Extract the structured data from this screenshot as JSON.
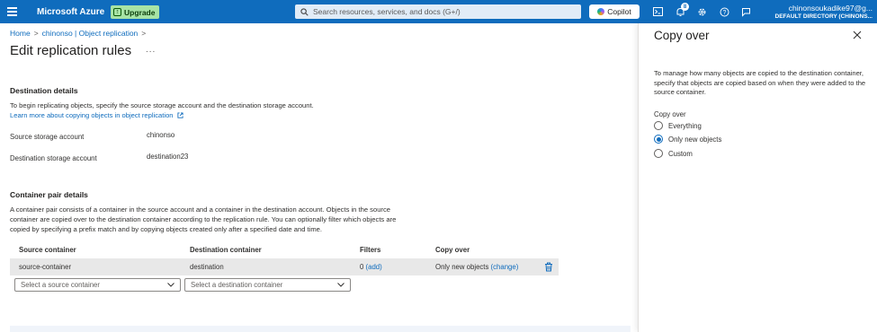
{
  "topbar": {
    "brand": "Microsoft Azure",
    "upgrade_label": "Upgrade",
    "search_placeholder": "Search resources, services, and docs (G+/)",
    "copilot_label": "Copilot",
    "notification_count": "8",
    "account_email": "chinonsoukadike97@g...",
    "account_directory": "DEFAULT DIRECTORY (CHINONS..."
  },
  "breadcrumb": {
    "items": [
      "Home",
      "chinonso | Object replication"
    ],
    "separator": ">"
  },
  "page": {
    "title": "Edit replication rules",
    "more_label": "..."
  },
  "destination_details": {
    "title": "Destination details",
    "description": "To begin replicating objects, specify the source storage account and the destination storage account.",
    "link": "Learn more about copying objects in object replication",
    "source_label": "Source storage account",
    "source_value": "chinonso",
    "destination_label": "Destination storage account",
    "destination_value": "destination23"
  },
  "container_pair": {
    "title": "Container pair details",
    "description_lines": [
      "A container pair consists of a container in the source account and a container in the destination account. Objects in the source",
      "container are copied over to the destination container according to the replication rule. You can optionally filter which objects are",
      "copied by specifying a prefix match and by copying objects created only after a specified date and time."
    ],
    "columns": [
      "Source container",
      "Destination container",
      "Filters",
      "Copy over"
    ],
    "row": {
      "source": "source-container",
      "destination": "destination",
      "filters_count": "0",
      "filters_link": "(add)",
      "copy_over": "Only new objects",
      "copy_over_link": "(change)"
    },
    "source_select_placeholder": "Select a source container",
    "destination_select_placeholder": "Select a destination container"
  },
  "panel": {
    "title": "Copy over",
    "description": "To manage how many objects are copied to the destination container, specify that objects are copied based on when they were added to the source container.",
    "group_label": "Copy over",
    "options": [
      {
        "label": "Everything",
        "checked": false
      },
      {
        "label": "Only new objects",
        "checked": true
      },
      {
        "label": "Custom",
        "checked": false
      }
    ]
  },
  "colors": {
    "topbar": "#0f6cbd",
    "accent": "#0f6cbd",
    "upgrade": "#a7e3a5"
  }
}
